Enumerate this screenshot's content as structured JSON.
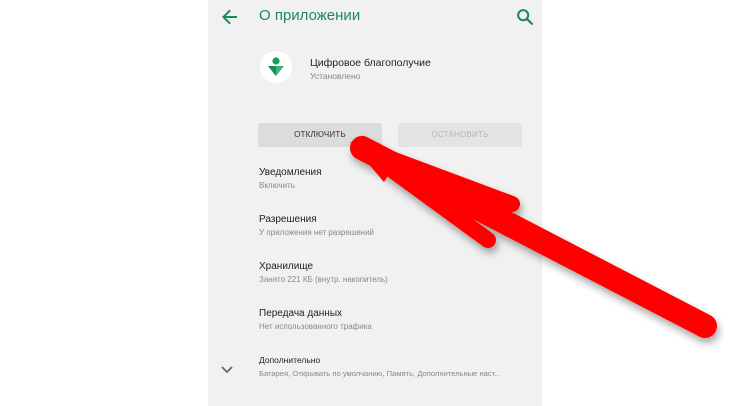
{
  "appbar": {
    "title": "О приложении"
  },
  "app": {
    "name": "Цифровое благополучие",
    "status": "Установлено"
  },
  "buttons": {
    "disable_label": "ОТКЛЮЧИТЬ",
    "stop_label": "ОСТАНОВИТЬ"
  },
  "settings": [
    {
      "title": "Уведомления",
      "subtitle": "Включить"
    },
    {
      "title": "Разрешения",
      "subtitle": "У приложения нет разрешений"
    },
    {
      "title": "Хранилище",
      "subtitle": "Занято 221 КБ (внутр. накопитель)"
    },
    {
      "title": "Передача данных",
      "subtitle": "Нет использованного трафика"
    }
  ],
  "advanced": {
    "title": "Дополнительно",
    "subtitle": "Батарея, Открывать по умолчанию, Память, Дополнительные наст..."
  },
  "icons": {
    "back": "arrow-back-icon",
    "search": "search-icon",
    "app": "digital-wellbeing-icon",
    "expand": "chevron-down-icon",
    "annotation": "red-arrow-annotation"
  },
  "colors": {
    "accent": "#1b8a57",
    "panel": "#f1f1f1",
    "annotation": "#ff0000"
  }
}
